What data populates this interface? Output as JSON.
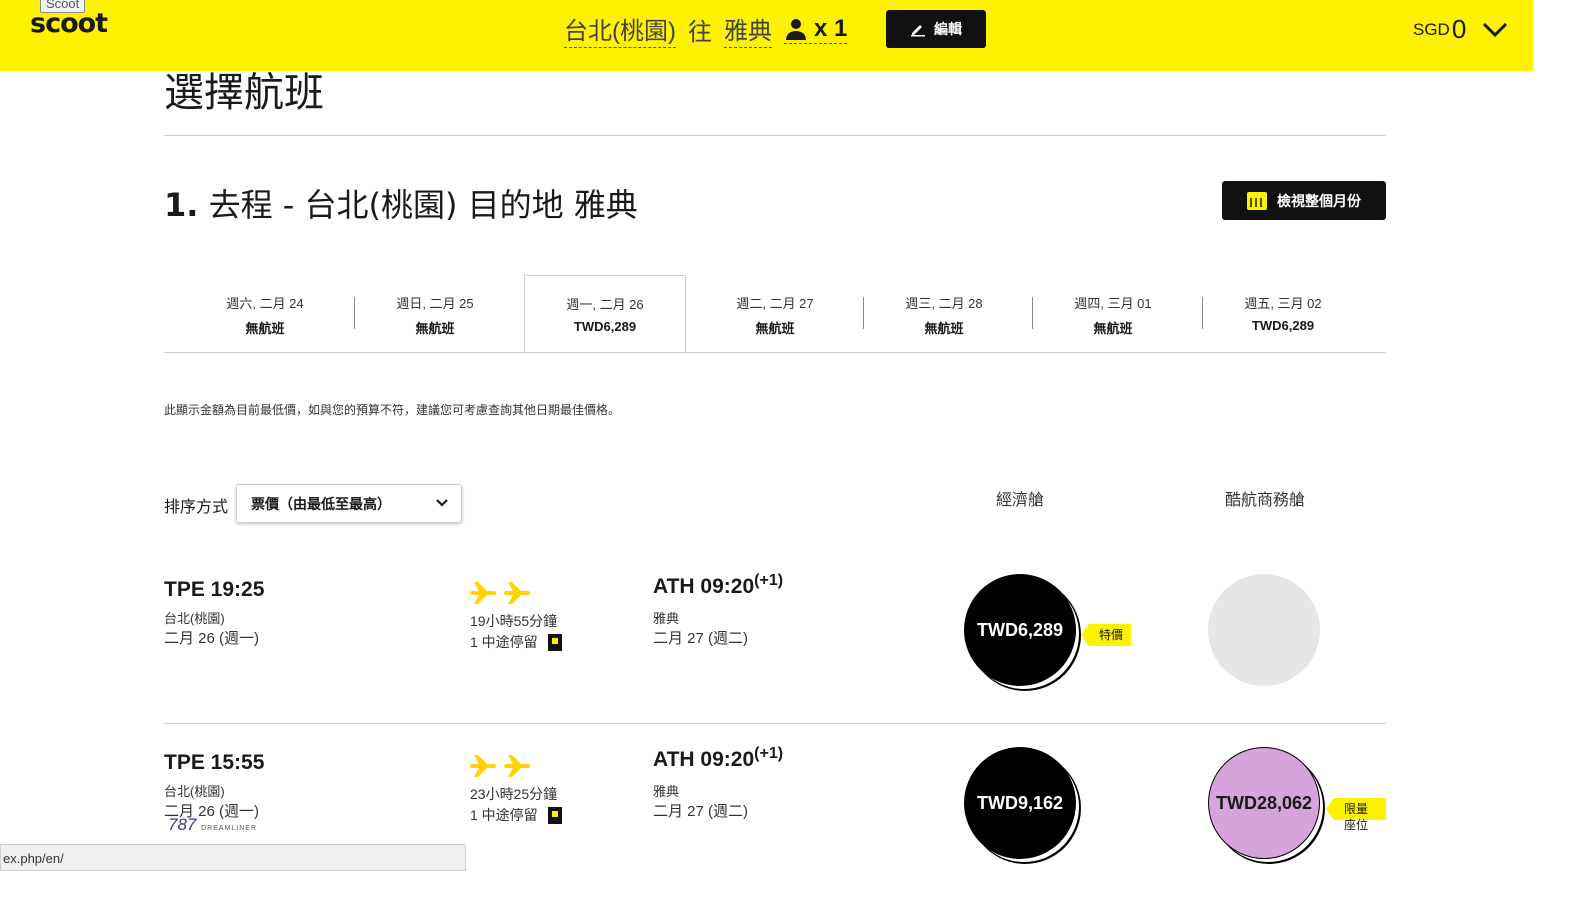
{
  "header": {
    "logo_tooltip": "Scoot",
    "logo_text": "scoot",
    "origin": "台北(桃園)",
    "connector": "往",
    "destination": "雅典",
    "pax_label": "x 1",
    "edit_label": "編輯",
    "currency": "SGD",
    "amount": "0"
  },
  "page": {
    "title": "選擇航班",
    "leg_number": "1.",
    "leg_title": "去程 - 台北(桃園) 目的地 雅典",
    "month_button": "檢視整個月份",
    "note": "此顯示金額為目前最低價，如與您的預算不符，建議您可考慮查詢其他日期最佳價格。",
    "sort_label": "排序方式",
    "sort_value": "票價（由最低至最高）",
    "economy_header": "經濟艙",
    "business_header": "酷航商務艙",
    "status_url": "ex.php/en/"
  },
  "date_tabs": [
    {
      "date": "週六, 二月 24",
      "price": "無航班"
    },
    {
      "date": "週日, 二月 25",
      "price": "無航班"
    },
    {
      "date": "週一, 二月 26",
      "price": "TWD6,289",
      "active": true
    },
    {
      "date": "週二, 二月 27",
      "price": "無航班"
    },
    {
      "date": "週三, 二月 28",
      "price": "無航班"
    },
    {
      "date": "週四, 三月 01",
      "price": "無航班"
    },
    {
      "date": "週五, 三月 02",
      "price": "TWD6,289"
    }
  ],
  "flights": [
    {
      "dep": "TPE 19:25",
      "dep_city": "台北(桃園)",
      "dep_date": "二月 26 (週一)",
      "duration": "19小時55分鐘",
      "stops": "1 中途停留",
      "arr": "ATH 09:20",
      "arr_offset": "(+1)",
      "arr_city": "雅典",
      "arr_date": "二月 27 (週二)",
      "economy_price": "TWD6,289",
      "economy_tag": "特價",
      "business_price": "",
      "business_tag": ""
    },
    {
      "dep": "TPE 15:55",
      "dep_city": "台北(桃園)",
      "dep_date": "二月 26 (週一)",
      "duration": "23小時25分鐘",
      "stops": "1 中途停留",
      "arr": "ATH 09:20",
      "arr_offset": "(+1)",
      "arr_city": "雅典",
      "arr_date": "二月 27 (週二)",
      "economy_price": "TWD9,162",
      "economy_tag": "",
      "business_price": "TWD28,062",
      "business_tag": "限量座位",
      "aircraft": "787",
      "aircraft_sub": "DREAMLINER"
    }
  ],
  "colors": {
    "brand_yellow": "#fff200",
    "business_purple": "#d7a3dd",
    "black": "#000000"
  }
}
